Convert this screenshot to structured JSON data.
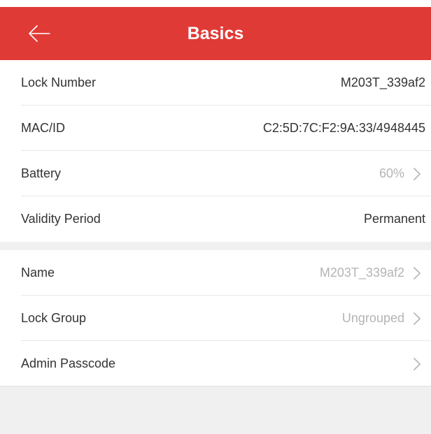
{
  "header": {
    "title": "Basics",
    "back_icon": "arrow-left-icon",
    "background_color": "#e03a36"
  },
  "lock_info": {
    "rows": [
      {
        "label": "Lock Number",
        "value": "M203T_339af2"
      },
      {
        "label": "MAC/ID",
        "value": "C2:5D:7C:F2:9A:33/4948445"
      },
      {
        "label": "Battery",
        "value": "60%",
        "chevron": "chevron-right-icon"
      },
      {
        "label": "Validity Period",
        "value": "Permanent"
      }
    ]
  },
  "settings": {
    "rows": [
      {
        "label": "Name",
        "value": "M203T_339af2",
        "chevron": "chevron-right-icon"
      },
      {
        "label": "Lock Group",
        "value": "Ungrouped",
        "chevron": "chevron-right-icon"
      },
      {
        "label": "Admin Passcode",
        "value": "",
        "chevron": "chevron-right-icon"
      }
    ]
  }
}
